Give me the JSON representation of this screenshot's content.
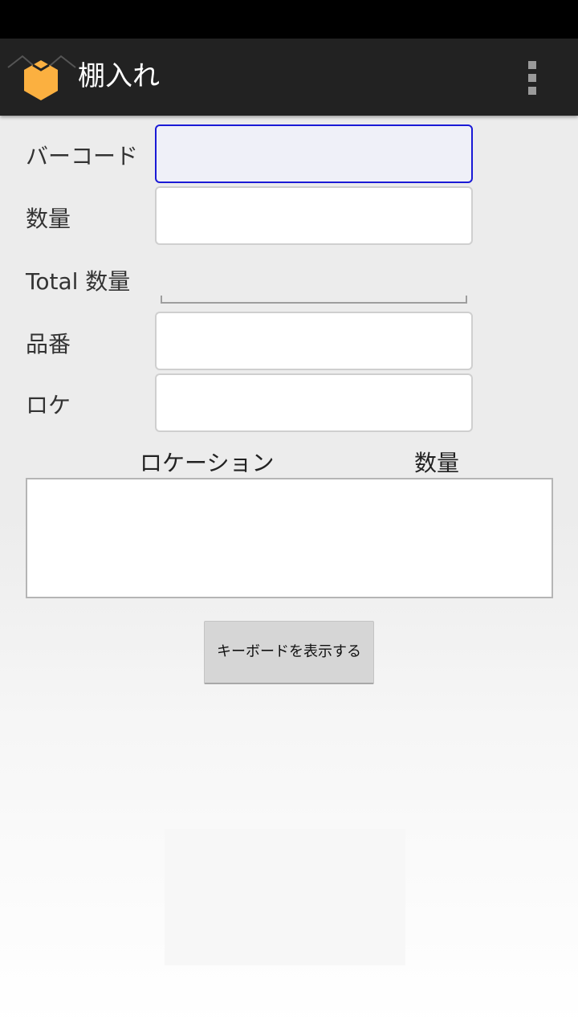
{
  "app": {
    "title": "棚入れ",
    "icon": "hexagon-box-icon",
    "menu_icon": "overflow-menu-icon",
    "accent_color": "#FBB040",
    "action_bar_color": "#222222"
  },
  "form": {
    "barcode": {
      "label": "バーコード",
      "value": ""
    },
    "quantity": {
      "label": "数量",
      "value": ""
    },
    "total_quantity": {
      "label": "Total 数量",
      "value": ""
    },
    "part_number": {
      "label": "品番",
      "value": ""
    },
    "location": {
      "label": "ロケ",
      "value": ""
    }
  },
  "location_list": {
    "columns": [
      "ロケーション",
      "数量"
    ],
    "rows": []
  },
  "keyboard_button": {
    "label": "キーボードを表示する"
  }
}
